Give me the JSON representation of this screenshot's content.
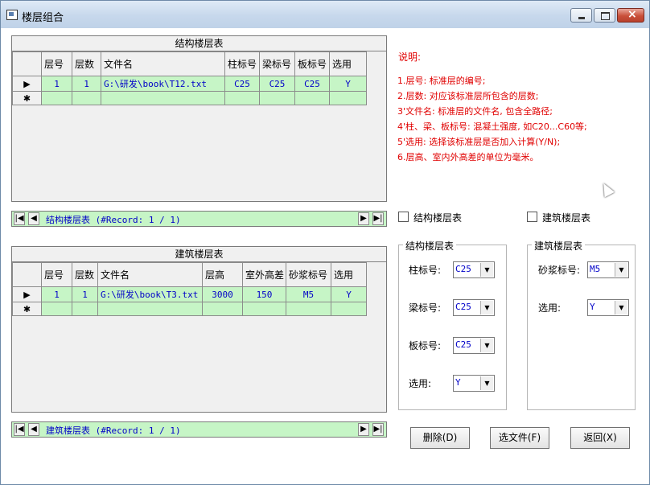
{
  "window": {
    "title": "楼层组合",
    "buttons": {
      "minimize": "minimize-icon",
      "maximize": "maximize-icon",
      "close": "close-icon"
    }
  },
  "struct_grid": {
    "caption": "结构楼层表",
    "columns": [
      "层号",
      "层数",
      "文件名",
      "柱标号",
      "梁标号",
      "板标号",
      "选用"
    ],
    "rows": [
      {
        "floor_no": "1",
        "count": "1",
        "file": "G:\\研发\\book\\T12.txt",
        "col_grade": "C25",
        "beam_grade": "C25",
        "slab_grade": "C25",
        "use": "Y"
      }
    ],
    "current_marker": "▶",
    "new_marker": "✱"
  },
  "struct_nav": {
    "text": "结构楼层表 (#Record:  1 / 1)"
  },
  "arch_grid": {
    "caption": "建筑楼层表",
    "columns": [
      "层号",
      "层数",
      "文件名",
      "层高",
      "室外高差",
      "砂浆标号",
      "选用"
    ],
    "rows": [
      {
        "floor_no": "1",
        "count": "1",
        "file": "G:\\研发\\book\\T3.txt",
        "height": "3000",
        "outdoor_diff": "150",
        "mortar": "M5",
        "use": "Y"
      }
    ],
    "current_marker": "▶",
    "new_marker": "✱"
  },
  "arch_nav": {
    "text": "建筑楼层表 (#Record:  1 / 1)"
  },
  "notes": {
    "title": "说明:",
    "lines": [
      "1.层号: 标准层的编号;",
      "2.层数: 对应该标准层所包含的层数;",
      "3'文件名: 标准层的文件名, 包含全路径;",
      "4'柱、梁、板标号: 混凝土强度, 如C20...C60等;",
      "5'选用: 选择该标准层是否加入计算(Y/N);",
      "6.层高、室内外高差的单位为毫米。"
    ]
  },
  "checks": {
    "struct": "结构楼层表",
    "arch": "建筑楼层表"
  },
  "struct_group": {
    "title": "结构楼层表",
    "col_label": "柱标号:",
    "col_value": "C25",
    "beam_label": "梁标号:",
    "beam_value": "C25",
    "slab_label": "板标号:",
    "slab_value": "C25",
    "use_label": "选用:",
    "use_value": "Y"
  },
  "arch_group": {
    "title": "建筑楼层表",
    "mortar_label": "砂浆标号:",
    "mortar_value": "M5",
    "use_label": "选用:",
    "use_value": "Y"
  },
  "buttons": {
    "delete": "删除(D)",
    "choose_file": "选文件(F)",
    "back": "返回(X)"
  },
  "nav_glyphs": {
    "first": "|◀",
    "prev": "◀",
    "next": "▶",
    "last": "▶|"
  }
}
